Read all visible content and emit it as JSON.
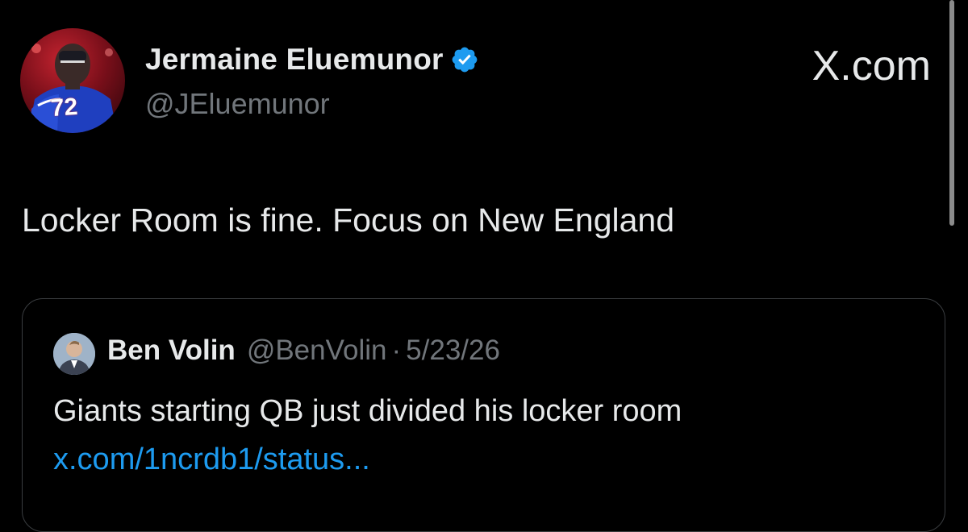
{
  "author": {
    "display_name": "Jermaine Eluemunor",
    "handle": "@JEluemunor",
    "verified": true,
    "avatar_icon": "football-player-avatar",
    "jersey_number": "72"
  },
  "brand": {
    "label": "X.com"
  },
  "tweet": {
    "text": "Locker Room is fine. Focus on New England"
  },
  "quoted_tweet": {
    "author_name": "Ben Volin",
    "author_handle": "@BenVolin",
    "separator": "·",
    "date": "5/23/26",
    "text": "Giants starting QB just divided his locker room",
    "link_text": "x.com/1ncrdb1/status..."
  },
  "colors": {
    "background": "#000000",
    "primary_text": "#e7e9ea",
    "secondary_text": "#71767b",
    "link": "#1d9bf0",
    "verified_badge": "#1d9bf0",
    "card_border": "#3a3d40"
  }
}
